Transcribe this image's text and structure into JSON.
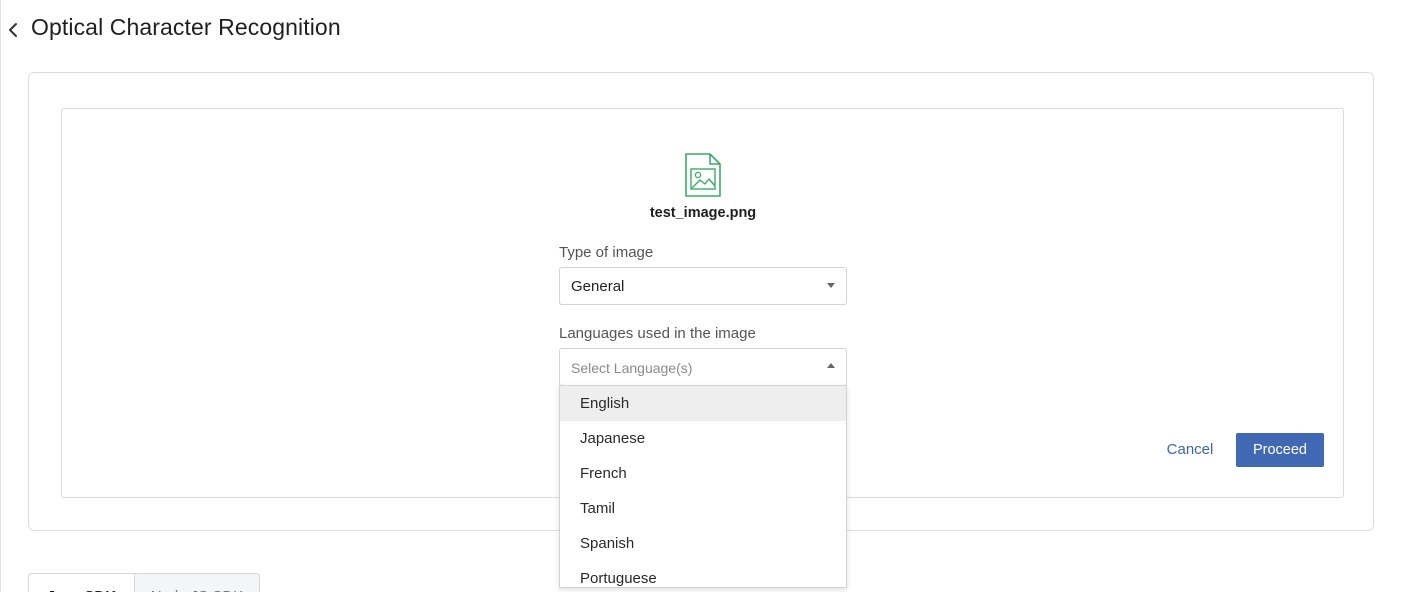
{
  "header": {
    "title": "Optical Character Recognition"
  },
  "file": {
    "name": "test_image.png",
    "icon": "image-file-icon",
    "icon_color": "#3daa6a"
  },
  "image_type": {
    "label": "Type of image",
    "value": "General"
  },
  "languages": {
    "label": "Languages used in the image",
    "placeholder": "Select Language(s)",
    "options": [
      "English",
      "Japanese",
      "French",
      "Tamil",
      "Spanish",
      "Portuguese"
    ],
    "highlighted": "English"
  },
  "actions": {
    "cancel_label": "Cancel",
    "proceed_label": "Proceed",
    "accent_color": "#4168b3"
  },
  "tabs": [
    {
      "label": "Java SDK",
      "active": true
    },
    {
      "label": "Node JS SDK",
      "active": false
    }
  ]
}
